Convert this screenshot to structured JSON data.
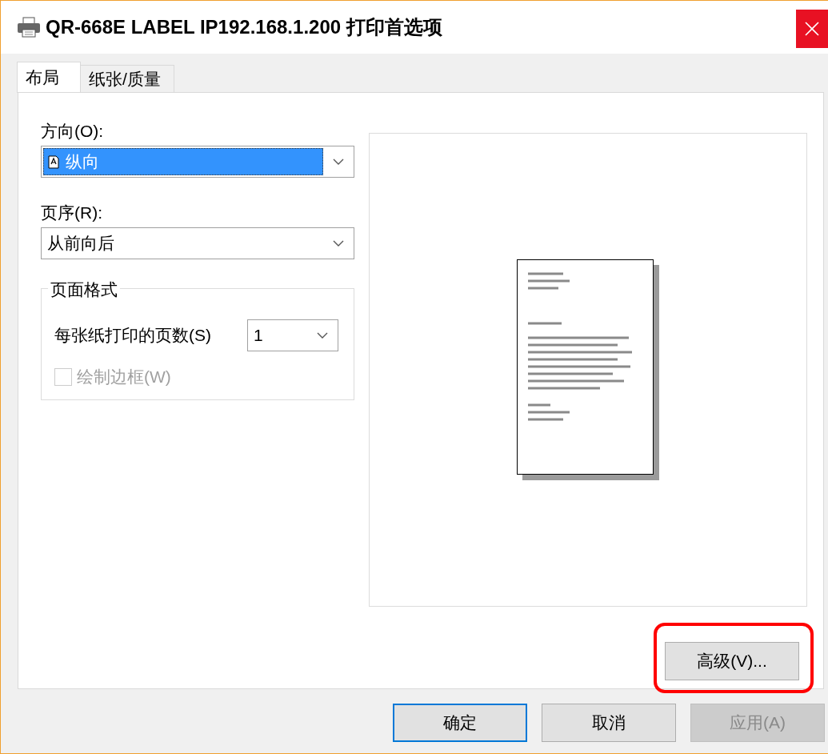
{
  "window": {
    "title": "QR-668E LABEL IP192.168.1.200 打印首选项"
  },
  "tabs": [
    {
      "label": "布局",
      "selected": true
    },
    {
      "label": "纸张/质量",
      "selected": false
    }
  ],
  "orientation": {
    "label": "方向(O):",
    "value": "纵向",
    "focused": true
  },
  "page_order": {
    "label": "页序(R):",
    "value": "从前向后",
    "focused": false
  },
  "page_format": {
    "title": "页面格式",
    "pages_per_sheet": {
      "label": "每张纸打印的页数(S)",
      "value": "1"
    },
    "draw_borders": {
      "label": "绘制边框(W)",
      "checked": false,
      "disabled": true
    }
  },
  "advanced_button": {
    "label": "高级(V)...",
    "highlighted": true
  },
  "buttons": [
    {
      "label": "确定",
      "default": true,
      "disabled": false
    },
    {
      "label": "取消",
      "default": false,
      "disabled": false
    },
    {
      "label": "应用(A)",
      "default": false,
      "disabled": true
    }
  ]
}
